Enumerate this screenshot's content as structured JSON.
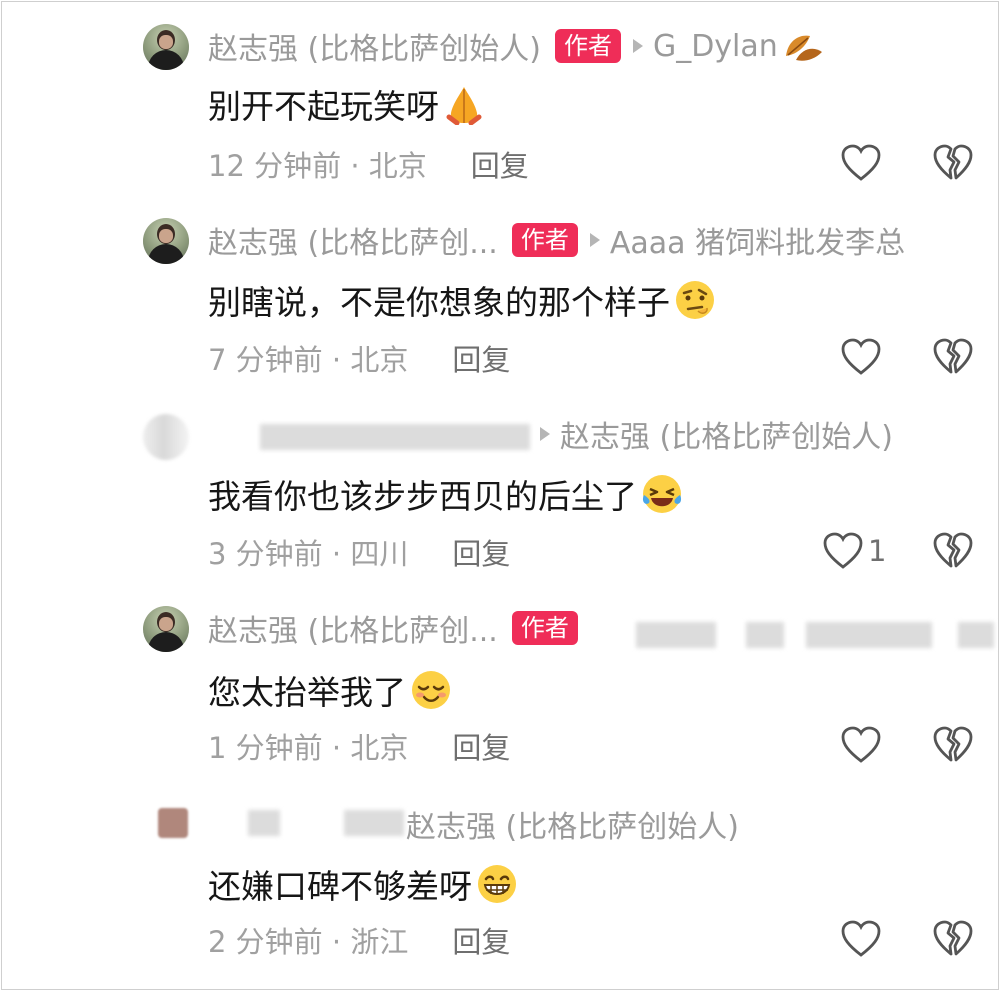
{
  "comments": [
    {
      "author": "赵志强 (比格比萨创始人)",
      "badge": "作者",
      "reply_to": "G_Dylan",
      "text": "别开不起玩笑呀",
      "emoji": "folded-hands-emoji",
      "time_location": "12 分钟前 · 北京",
      "reply_label": "回复",
      "like_count": ""
    },
    {
      "author": "赵志强 (比格比萨创...",
      "badge": "作者",
      "reply_to": "Aaaa 猪饲料批发李总",
      "text": "别瞎说，不是你想象的那个样子",
      "emoji": "raised-eyebrow-emoji",
      "time_location": "7 分钟前 · 北京",
      "reply_label": "回复",
      "like_count": ""
    },
    {
      "author": "",
      "badge": "",
      "reply_to": "赵志强 (比格比萨创始人)",
      "text": "我看你也该步步西贝的后尘了",
      "emoji": "laughing-tears-emoji",
      "time_location": "3 分钟前 · 四川",
      "reply_label": "回复",
      "like_count": "1"
    },
    {
      "author": "赵志强 (比格比萨创...",
      "badge": "作者",
      "reply_to": "",
      "text": "您太抬举我了",
      "emoji": "shy-smile-emoji",
      "time_location": "1 分钟前 · 北京",
      "reply_label": "回复",
      "like_count": ""
    },
    {
      "author": "",
      "badge": "",
      "reply_to": "赵志强 (比格比萨创始人)",
      "text": "还嫌口碑不够差呀",
      "emoji": "grinning-emoji",
      "time_location": "2 分钟前 · 浙江",
      "reply_label": "回复",
      "like_count": ""
    }
  ]
}
